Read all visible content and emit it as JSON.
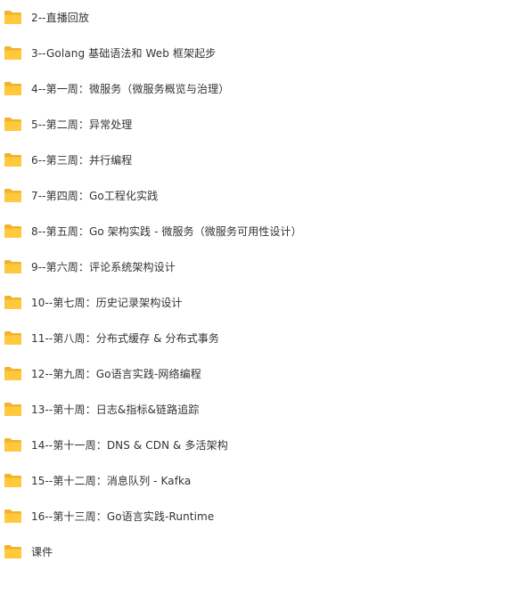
{
  "folder_color": "#FFC83D",
  "folder_tab_color": "#F0B32A",
  "text_color": "#333333",
  "icon": "folder-icon",
  "items": [
    {
      "label": "2--直播回放"
    },
    {
      "label": "3--Golang 基础语法和 Web 框架起步"
    },
    {
      "label": "4--第一周：微服务（微服务概览与治理）"
    },
    {
      "label": "5--第二周：异常处理"
    },
    {
      "label": "6--第三周：并行编程"
    },
    {
      "label": "7--第四周：Go工程化实践"
    },
    {
      "label": "8--第五周：Go 架构实践 - 微服务（微服务可用性设计）"
    },
    {
      "label": "9--第六周：评论系统架构设计"
    },
    {
      "label": "10--第七周：历史记录架构设计"
    },
    {
      "label": "11--第八周：分布式缓存 & 分布式事务"
    },
    {
      "label": "12--第九周：Go语言实践-网络编程"
    },
    {
      "label": "13--第十周：日志&指标&链路追踪"
    },
    {
      "label": "14--第十一周：DNS & CDN & 多活架构"
    },
    {
      "label": "15--第十二周：消息队列 - Kafka"
    },
    {
      "label": "16--第十三周：Go语言实践-Runtime"
    },
    {
      "label": "课件"
    }
  ]
}
